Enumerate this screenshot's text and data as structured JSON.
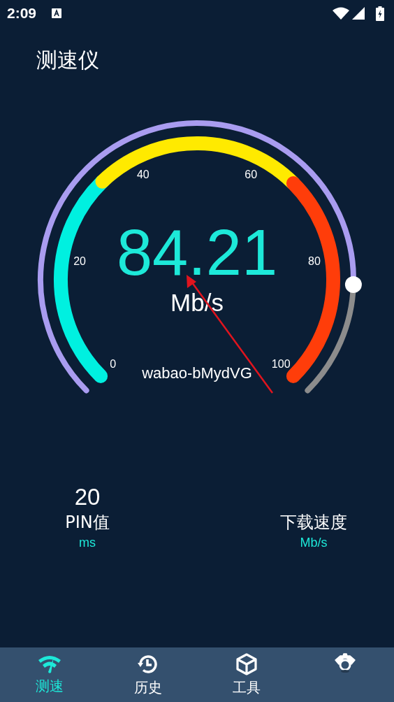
{
  "status_bar": {
    "time": "2:09"
  },
  "title": "测速仪",
  "gauge": {
    "value": "84.21",
    "unit": "Mb/s",
    "network": "wabao-bMydVG",
    "ticks": [
      "0",
      "20",
      "40",
      "60",
      "80",
      "100"
    ],
    "segments": [
      {
        "color": "#00f0e0"
      },
      {
        "color": "#ffea00"
      },
      {
        "color": "#ff3d0a"
      }
    ],
    "annotation": {
      "kind": "arrow"
    }
  },
  "stats": [
    {
      "value": "20",
      "label": "PIN值",
      "unit": "ms"
    },
    {
      "label": "下载速度",
      "unit": "Mb/s"
    }
  ],
  "nav": [
    {
      "label": "测速",
      "selected": true
    },
    {
      "label": "历史",
      "selected": false
    },
    {
      "label": "工具",
      "selected": false
    },
    {
      "selected": false
    }
  ]
}
